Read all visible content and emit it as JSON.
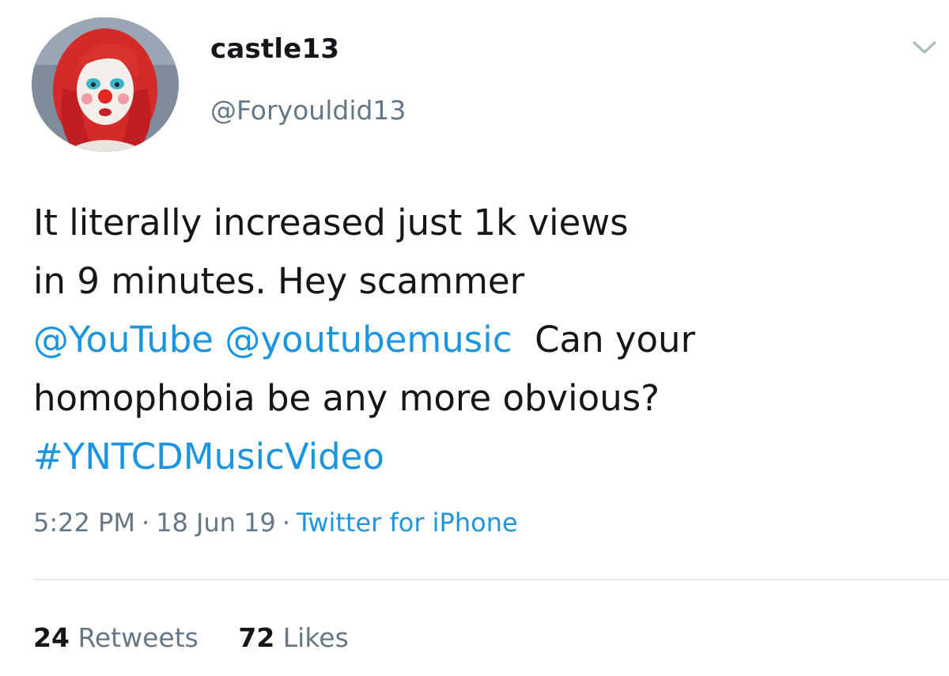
{
  "author": {
    "display_name": "castle13",
    "handle": "@Foryouldid13"
  },
  "tweet": {
    "line1": "It literally increased just 1k views",
    "line2": "in 9 minutes. Hey scammer",
    "mention1": "@YouTube",
    "mention2": "@youtubemusic",
    "line3_rest": "Can your",
    "line4": "homophobia be any more obvious?",
    "hashtag": "#YNTCDMusicVideo"
  },
  "meta": {
    "time": "5:22 PM",
    "date": "18 Jun 19",
    "separator": "·",
    "source": "Twitter for iPhone"
  },
  "stats": {
    "retweets_count": "24",
    "retweets_label": "Retweets",
    "likes_count": "72",
    "likes_label": "Likes"
  },
  "icons": {
    "menu": "chevron-down-icon",
    "avatar": "avatar"
  },
  "colors": {
    "link": "#1b95e0",
    "secondary_text": "#657786",
    "primary_text": "#14171a",
    "divider": "#e6ecf0"
  }
}
